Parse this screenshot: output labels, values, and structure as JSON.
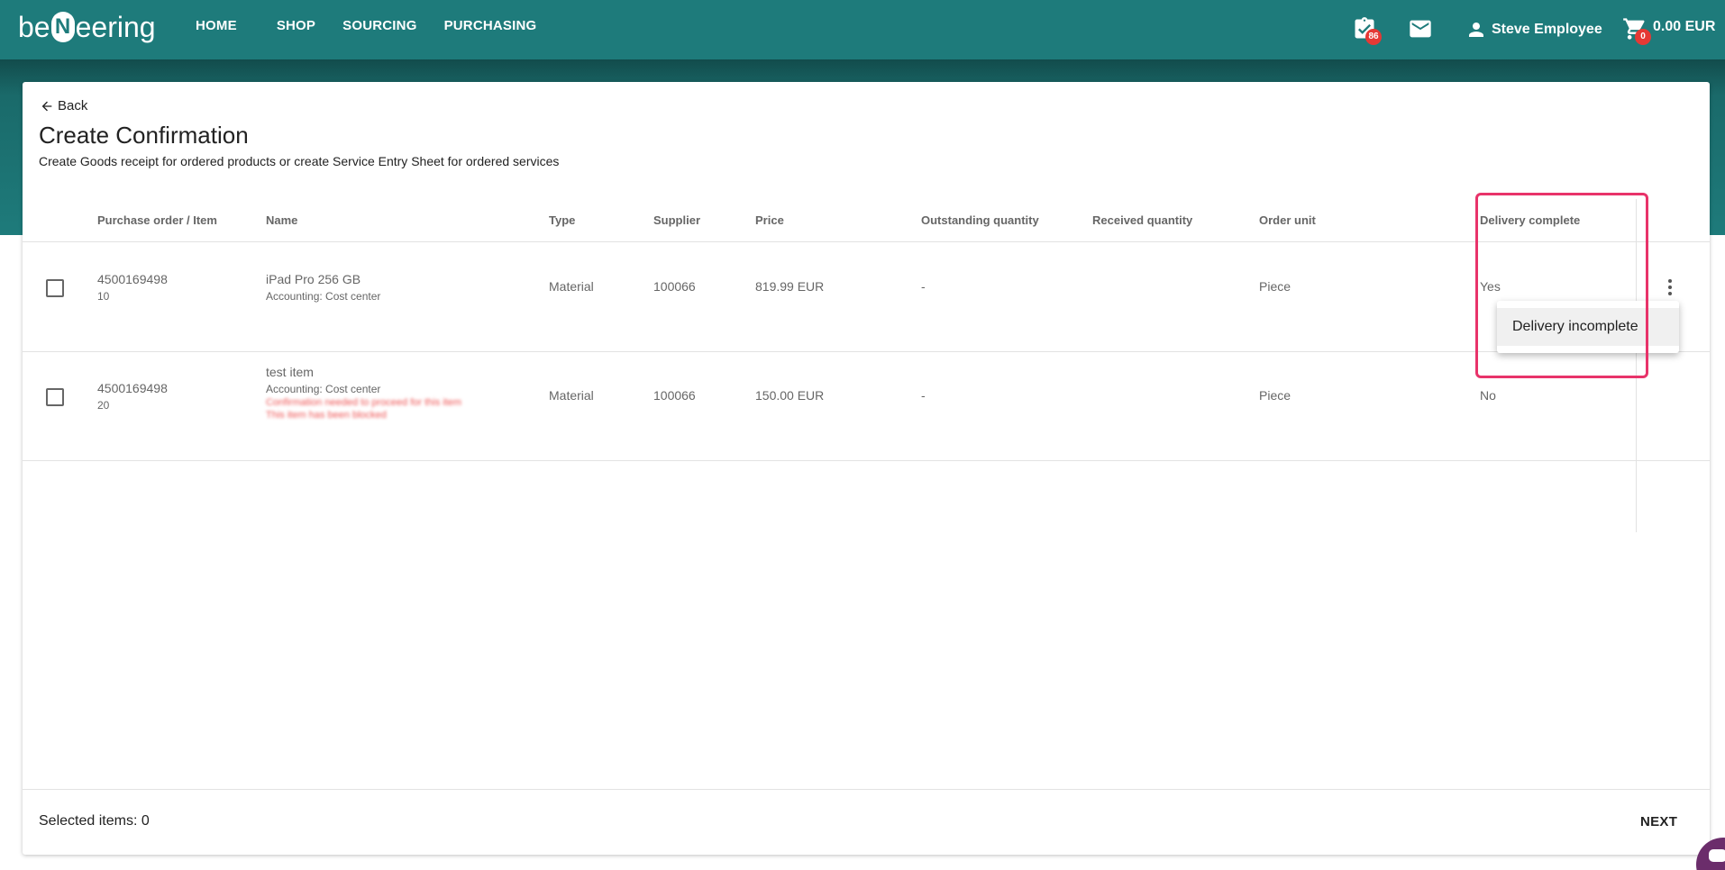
{
  "app": {
    "logo_pre": "be",
    "logo_mark": "N",
    "logo_post": "eering"
  },
  "nav": {
    "items": [
      {
        "label": "HOME"
      },
      {
        "label": "SHOP"
      },
      {
        "label": "SOURCING"
      },
      {
        "label": "PURCHASING"
      }
    ]
  },
  "header": {
    "tasks_icon": "clipboard-check-icon",
    "tasks_badge": "86",
    "mail_icon": "mail-icon",
    "user_icon": "person-icon",
    "user_name": "Steve Employee",
    "cart_icon": "cart-icon",
    "cart_badge": "0",
    "cart_total": "0.00 EUR"
  },
  "page": {
    "back_label": "Back",
    "title": "Create Confirmation",
    "subtitle": "Create Goods receipt for ordered products or create Service Entry Sheet for ordered services"
  },
  "table": {
    "columns": [
      {
        "label": "Purchase order / Item"
      },
      {
        "label": "Name"
      },
      {
        "label": "Type"
      },
      {
        "label": "Supplier"
      },
      {
        "label": "Price"
      },
      {
        "label": "Outstanding quantity"
      },
      {
        "label": "Received quantity"
      },
      {
        "label": "Order unit"
      },
      {
        "label": "Delivery complete"
      }
    ],
    "rows": [
      {
        "po": "4500169498",
        "item": "10",
        "name": "iPad Pro 256 GB",
        "accounting": "Accounting:  Cost center",
        "type": "Material",
        "supplier": "100066",
        "price": "819.99 EUR",
        "outstanding": "-",
        "received": "",
        "unit": "Piece",
        "delivery_complete": "Yes"
      },
      {
        "po": "4500169498",
        "item": "20",
        "name": "test item",
        "accounting": "Accounting:  Cost center",
        "warning_line1": "Confirmation needed to proceed for this item",
        "warning_line2": "This item has been blocked",
        "type": "Material",
        "supplier": "100066",
        "price": "150.00 EUR",
        "outstanding": "-",
        "received": "",
        "unit": "Piece",
        "delivery_complete": "No"
      }
    ]
  },
  "context_menu": {
    "item_label": "Delivery incomplete"
  },
  "footer": {
    "selected_label": "Selected items: 0",
    "next_label": "NEXT"
  },
  "colors": {
    "primary": "#1e7b7b",
    "badge": "#e53935",
    "highlight": "#e8336a"
  }
}
